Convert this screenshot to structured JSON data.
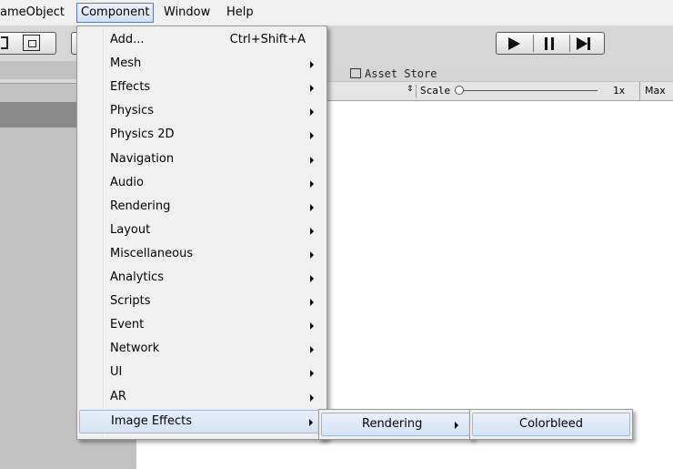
{
  "menubar": {
    "items": [
      "ameObject",
      "Component",
      "Window",
      "Help"
    ]
  },
  "tabs": {
    "asset_store": "Asset Store"
  },
  "scene_controls": {
    "scale_label": "Scale",
    "scale_value": "1x",
    "max_label": "Max"
  },
  "component_menu": {
    "items": [
      {
        "label": "Add...",
        "shortcut": "Ctrl+Shift+A",
        "submenu": false
      },
      {
        "label": "Mesh",
        "submenu": true
      },
      {
        "label": "Effects",
        "submenu": true
      },
      {
        "label": "Physics",
        "submenu": true
      },
      {
        "label": "Physics 2D",
        "submenu": true
      },
      {
        "label": "Navigation",
        "submenu": true
      },
      {
        "label": "Audio",
        "submenu": true
      },
      {
        "label": "Rendering",
        "submenu": true
      },
      {
        "label": "Layout",
        "submenu": true
      },
      {
        "label": "Miscellaneous",
        "submenu": true
      },
      {
        "label": "Analytics",
        "submenu": true
      },
      {
        "label": "Scripts",
        "submenu": true
      },
      {
        "label": "Event",
        "submenu": true
      },
      {
        "label": "Network",
        "submenu": true
      },
      {
        "label": "UI",
        "submenu": true
      },
      {
        "label": "AR",
        "submenu": true
      },
      {
        "label": "Image Effects",
        "submenu": true,
        "highlighted": true
      }
    ]
  },
  "image_effects_menu": {
    "items": [
      {
        "label": "Rendering",
        "submenu": true,
        "highlighted": true
      }
    ]
  },
  "rendering_menu": {
    "items": [
      {
        "label": "Colorbleed",
        "highlighted": true
      }
    ]
  },
  "icons": [
    "rect-tool-icon",
    "transform-tool-icon",
    "play-icon",
    "pause-icon",
    "step-icon",
    "asset-store-icon"
  ],
  "colors": {
    "menu_bg": "#f0f0f0",
    "highlight": "#d5e3f5",
    "highlight_border": "#9db6d8",
    "scene_bg": "#ffffff"
  }
}
